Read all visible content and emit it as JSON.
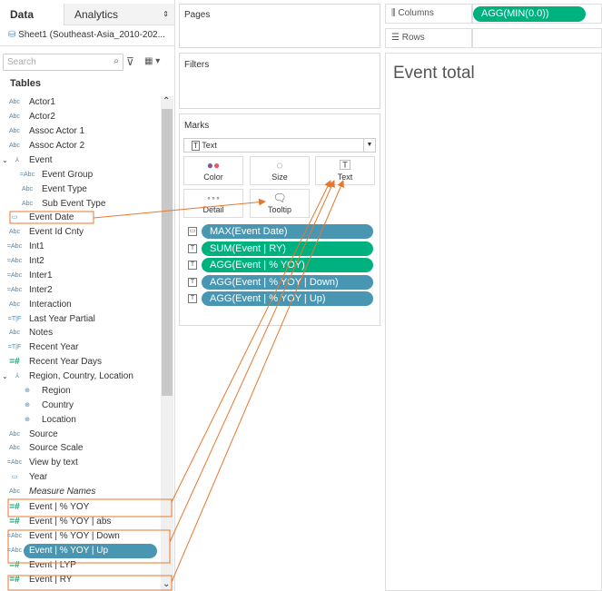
{
  "data_pane": {
    "tabs": [
      "Data",
      "Analytics"
    ],
    "datasource": "Sheet1 (Southeast-Asia_2010-202...",
    "search_placeholder": "Search",
    "tables_label": "Tables",
    "fields": [
      {
        "label": "Actor1",
        "icon": "Abc",
        "indent": 0
      },
      {
        "label": "Actor2",
        "icon": "Abc",
        "indent": 0
      },
      {
        "label": "Assoc Actor 1",
        "icon": "Abc",
        "indent": 0
      },
      {
        "label": "Assoc Actor 2",
        "icon": "Abc",
        "indent": 0
      },
      {
        "label": "Event",
        "icon": "hierarchy",
        "indent": 0
      },
      {
        "label": "Event Group",
        "icon": "=Abc",
        "indent": 1
      },
      {
        "label": "Event Type",
        "icon": "Abc",
        "indent": 1
      },
      {
        "label": "Sub Event Type",
        "icon": "Abc",
        "indent": 1
      },
      {
        "label": "Event Date",
        "icon": "calendar",
        "indent": 0,
        "highlighted": true
      },
      {
        "label": "Event Id Cnty",
        "icon": "Abc",
        "indent": 0
      },
      {
        "label": "Int1",
        "icon": "=Abc",
        "indent": 0
      },
      {
        "label": "Int2",
        "icon": "=Abc",
        "indent": 0
      },
      {
        "label": "Inter1",
        "icon": "=Abc",
        "indent": 0
      },
      {
        "label": "Inter2",
        "icon": "=Abc",
        "indent": 0
      },
      {
        "label": "Interaction",
        "icon": "Abc",
        "indent": 0
      },
      {
        "label": "Last Year Partial",
        "icon": "=T|F",
        "indent": 0
      },
      {
        "label": "Notes",
        "icon": "Abc",
        "indent": 0
      },
      {
        "label": "Recent Year",
        "icon": "=T|F",
        "indent": 0
      },
      {
        "label": "Recent Year Days",
        "icon": "=#",
        "indent": 0
      },
      {
        "label": "Region, Country, Location",
        "icon": "hierarchy",
        "indent": 0
      },
      {
        "label": "Region",
        "icon": "globe",
        "indent": 1
      },
      {
        "label": "Country",
        "icon": "globe",
        "indent": 1
      },
      {
        "label": "Location",
        "icon": "globe",
        "indent": 1
      },
      {
        "label": "Source",
        "icon": "Abc",
        "indent": 0
      },
      {
        "label": "Source Scale",
        "icon": "Abc",
        "indent": 0
      },
      {
        "label": "View by text",
        "icon": "=Abc",
        "indent": 0
      },
      {
        "label": "Year",
        "icon": "calendar",
        "indent": 0
      },
      {
        "label": "Measure Names",
        "icon": "Abc",
        "indent": 0,
        "italic": true
      },
      {
        "label": "Event | % YOY",
        "icon": "=#",
        "indent": 0,
        "highlighted": true
      },
      {
        "label": "Event | % YOY | abs",
        "icon": "=#",
        "indent": 0
      },
      {
        "label": "Event | % YOY | Down",
        "icon": "=Abc",
        "indent": 0,
        "highlighted": true
      },
      {
        "label": "Event | % YOY | Up",
        "icon": "=Abc",
        "indent": 0,
        "selected": true,
        "highlighted": true
      },
      {
        "label": "Event | LYP",
        "icon": "=#",
        "indent": 0
      },
      {
        "label": "Event | RY",
        "icon": "=#",
        "indent": 0,
        "highlighted": true
      }
    ]
  },
  "pages": {
    "label": "Pages"
  },
  "filters": {
    "label": "Filters"
  },
  "marks": {
    "label": "Marks",
    "type": "Text",
    "buttons": [
      "Color",
      "Size",
      "Text",
      "Detail",
      "Tooltip"
    ],
    "pills": [
      {
        "label": "MAX(Event Date)",
        "icon": "tooltip",
        "color": "#4996b2"
      },
      {
        "label": "SUM(Event | RY)",
        "icon": "text",
        "color": "#00b180"
      },
      {
        "label": "AGG(Event | % YOY)",
        "icon": "text",
        "color": "#00b180"
      },
      {
        "label": "AGG(Event | % YOY | Down)",
        "icon": "text",
        "color": "#4996b2"
      },
      {
        "label": "AGG(Event | % YOY | Up)",
        "icon": "text",
        "color": "#4996b2"
      }
    ]
  },
  "columns": {
    "label": "Columns",
    "pill": "AGG(MIN(0.0))"
  },
  "rows": {
    "label": "Rows"
  },
  "view": {
    "title": "Event total"
  },
  "colors": {
    "annotation": "#e8772e",
    "measure_pill": "#00b180",
    "dimension_pill": "#4996b2"
  }
}
